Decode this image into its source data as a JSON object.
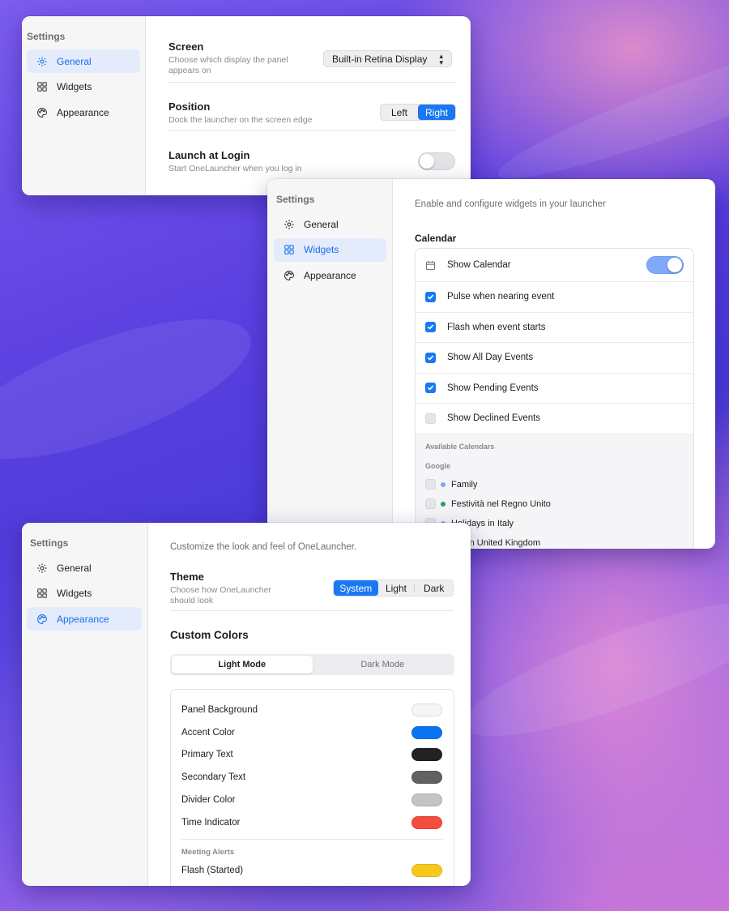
{
  "nav": {
    "title": "Settings",
    "general": "General",
    "widgets": "Widgets",
    "appearance": "Appearance"
  },
  "general": {
    "screen_title": "Screen",
    "screen_sub": "Choose which display the panel appears on",
    "screen_value": "Built-in Retina Display",
    "position_title": "Position",
    "position_sub": "Dock the launcher on the screen edge",
    "position_left": "Left",
    "position_right": "Right",
    "position_selected": "Right",
    "login_title": "Launch at Login",
    "login_sub": "Start OneLauncher when you log in",
    "login_on": false
  },
  "widgets": {
    "intro": "Enable and configure widgets in your launcher",
    "section": "Calendar",
    "show_calendar": "Show Calendar",
    "show_calendar_on": true,
    "options": [
      {
        "label": "Pulse when nearing event",
        "checked": true
      },
      {
        "label": "Flash when event starts",
        "checked": true
      },
      {
        "label": "Show All Day Events",
        "checked": true
      },
      {
        "label": "Show Pending Events",
        "checked": true
      },
      {
        "label": "Show Declined Events",
        "checked": false
      }
    ],
    "available_heading": "Available Calendars",
    "group": "Google",
    "calendars": [
      {
        "name": "Family",
        "color": "#7ea4f2"
      },
      {
        "name": "Festività nel Regno Unito",
        "color": "#2f9b5a"
      },
      {
        "name": "Holidays in Italy",
        "color": "#7ea4f2"
      },
      {
        "name": "ays in United Kingdom",
        "color": "#7ea4f2"
      }
    ]
  },
  "appearance": {
    "intro": "Customize the look and feel of OneLauncher.",
    "theme_title": "Theme",
    "theme_sub": "Choose how OneLauncher should look",
    "theme_system": "System",
    "theme_light": "Light",
    "theme_dark": "Dark",
    "theme_selected": "System",
    "custom_colors": "Custom Colors",
    "light_mode": "Light Mode",
    "dark_mode": "Dark Mode",
    "colors": [
      {
        "label": "Panel Background",
        "color": "#f5f5f7"
      },
      {
        "label": "Accent Color",
        "color": "#0a74f0"
      },
      {
        "label": "Primary Text",
        "color": "#222222"
      },
      {
        "label": "Secondary Text",
        "color": "#616161"
      },
      {
        "label": "Divider Color",
        "color": "#c4c4c4"
      },
      {
        "label": "Time Indicator",
        "color": "#f44c3e"
      }
    ],
    "alerts_heading": "Meeting Alerts",
    "alerts": [
      {
        "label": "Flash (Started)",
        "color": "#f8c81c"
      }
    ]
  }
}
